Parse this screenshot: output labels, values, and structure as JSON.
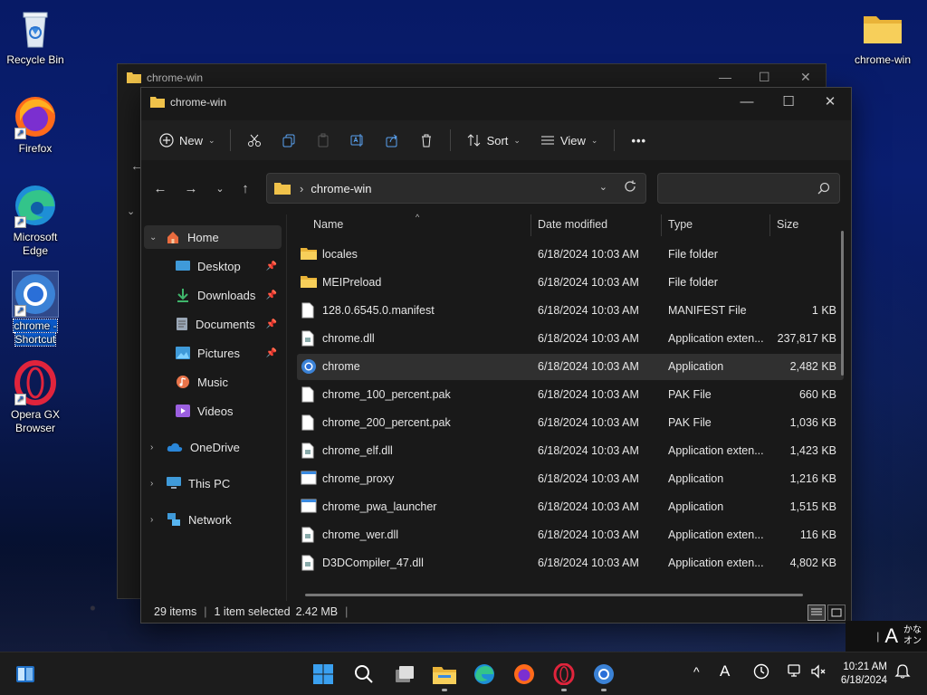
{
  "desktop": {
    "icons": [
      {
        "label": "Recycle Bin"
      },
      {
        "label": "Firefox"
      },
      {
        "label_line1": "Microsoft",
        "label_line2": "Edge"
      },
      {
        "label_line1": "chrome -",
        "label_line2": "Shortcut"
      },
      {
        "label_line1": "Opera GX",
        "label_line2": "Browser"
      },
      {
        "label": "chrome-win"
      }
    ]
  },
  "back_window": {
    "title": "chrome-win"
  },
  "window": {
    "title": "chrome-win",
    "toolbar": {
      "new_label": "New",
      "sort_label": "Sort",
      "view_label": "View",
      "more_label": "•••"
    },
    "address": {
      "path": "chrome-win"
    },
    "search": {
      "placeholder": ""
    },
    "nav": {
      "home": "Home",
      "desktop": "Desktop",
      "downloads": "Downloads",
      "documents": "Documents",
      "pictures": "Pictures",
      "music": "Music",
      "videos": "Videos",
      "onedrive": "OneDrive",
      "thispc": "This PC",
      "network": "Network"
    },
    "columns": {
      "name": "Name",
      "date": "Date modified",
      "type": "Type",
      "size": "Size"
    },
    "files": [
      {
        "name": "locales",
        "date": "6/18/2024 10:03 AM",
        "type": "File folder",
        "size": "",
        "icon": "folder-icon"
      },
      {
        "name": "MEIPreload",
        "date": "6/18/2024 10:03 AM",
        "type": "File folder",
        "size": "",
        "icon": "folder-icon"
      },
      {
        "name": "128.0.6545.0.manifest",
        "date": "6/18/2024 10:03 AM",
        "type": "MANIFEST File",
        "size": "1 KB",
        "icon": "file-icon"
      },
      {
        "name": "chrome.dll",
        "date": "6/18/2024 10:03 AM",
        "type": "Application exten...",
        "size": "237,817 KB",
        "icon": "dll-icon"
      },
      {
        "name": "chrome",
        "date": "6/18/2024 10:03 AM",
        "type": "Application",
        "size": "2,482 KB",
        "icon": "chrome-icon"
      },
      {
        "name": "chrome_100_percent.pak",
        "date": "6/18/2024 10:03 AM",
        "type": "PAK File",
        "size": "660 KB",
        "icon": "file-icon"
      },
      {
        "name": "chrome_200_percent.pak",
        "date": "6/18/2024 10:03 AM",
        "type": "PAK File",
        "size": "1,036 KB",
        "icon": "file-icon"
      },
      {
        "name": "chrome_elf.dll",
        "date": "6/18/2024 10:03 AM",
        "type": "Application exten...",
        "size": "1,423 KB",
        "icon": "dll-icon"
      },
      {
        "name": "chrome_proxy",
        "date": "6/18/2024 10:03 AM",
        "type": "Application",
        "size": "1,216 KB",
        "icon": "app-icon"
      },
      {
        "name": "chrome_pwa_launcher",
        "date": "6/18/2024 10:03 AM",
        "type": "Application",
        "size": "1,515 KB",
        "icon": "app-icon"
      },
      {
        "name": "chrome_wer.dll",
        "date": "6/18/2024 10:03 AM",
        "type": "Application exten...",
        "size": "116 KB",
        "icon": "dll-icon"
      },
      {
        "name": "D3DCompiler_47.dll",
        "date": "6/18/2024 10:03 AM",
        "type": "Application exten...",
        "size": "4,802 KB",
        "icon": "dll-icon"
      }
    ],
    "status": {
      "items": "29 items",
      "selected": "1 item selected",
      "size": "2.42 MB",
      "sep": "|"
    }
  },
  "ime": {
    "mode": "A",
    "kana_line1": "かな",
    "kana_line2": "オン"
  },
  "taskbar": {
    "time": "10:21 AM",
    "date": "6/18/2024",
    "tray_chevron": "^",
    "tray_font": "A"
  },
  "colors": {
    "accent": "#0a58c8",
    "folder": "#f0c24a",
    "taskbar": "#1c1c1c"
  }
}
